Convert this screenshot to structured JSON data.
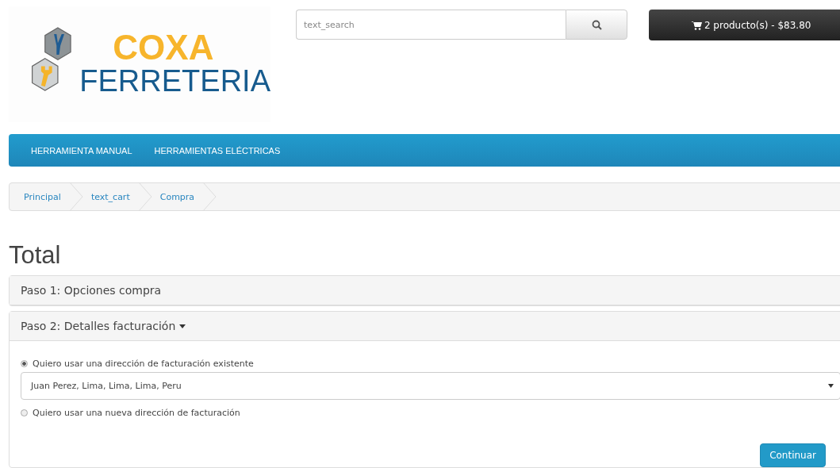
{
  "logo": {
    "line_1": "COXA",
    "line_2": "FERRETERIA"
  },
  "search": {
    "placeholder": "text_search"
  },
  "cart": {
    "label": "2 producto(s) - $83.80"
  },
  "menu": [
    {
      "label": "HERRAMIENTA MANUAL"
    },
    {
      "label": "HERRAMIENTAS ELÉCTRICAS"
    }
  ],
  "breadcrumb": [
    {
      "label": "Principal"
    },
    {
      "label": "text_cart"
    },
    {
      "label": "Compra"
    }
  ],
  "heading": "Total",
  "steps": [
    {
      "title": "Paso 1: Opciones compra",
      "expanded": false
    },
    {
      "title": "Paso 2: Detalles facturación",
      "expanded": true
    }
  ],
  "billing": {
    "options": [
      {
        "label": "Quiero usar una dirección de facturación existente",
        "selected": true
      },
      {
        "label": "Quiero usar una nueva dirección de facturación",
        "selected": false
      }
    ],
    "address": "Juan Perez, Lima, Lima, Lima, Peru",
    "button": "Continuar"
  }
}
